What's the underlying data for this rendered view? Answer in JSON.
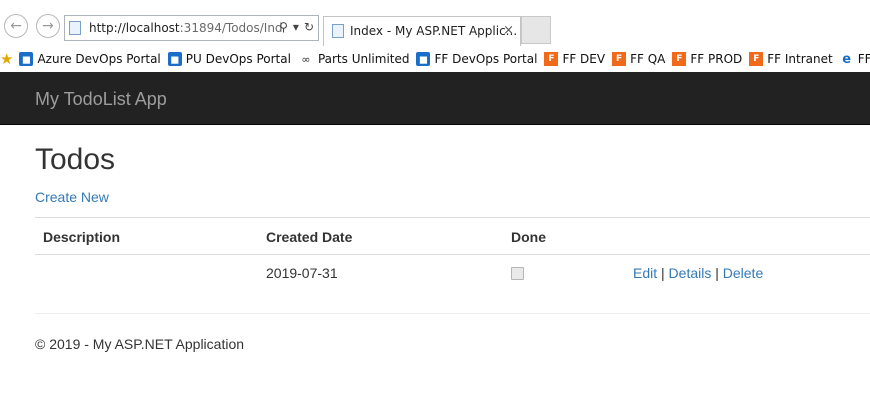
{
  "browser": {
    "address_url_host": "http://localhost",
    "address_url_rest": ":31894/Todos/Ind",
    "tab_title": "Index - My ASP.NET Applic...",
    "tab_close": "×",
    "back_icon": "←",
    "forward_icon": "→",
    "search_icon": "⚲",
    "dropdown_icon": "▾",
    "refresh_icon": "↻"
  },
  "favorites": [
    {
      "label": "Azure DevOps Portal",
      "icon": "devops-icon"
    },
    {
      "label": "PU DevOps Portal",
      "icon": "devops-icon"
    },
    {
      "label": "Parts Unlimited",
      "icon": "parts-icon"
    },
    {
      "label": "FF DevOps Portal",
      "icon": "devops-icon"
    },
    {
      "label": "FF DEV",
      "icon": "ff-icon"
    },
    {
      "label": "FF QA",
      "icon": "ff-icon"
    },
    {
      "label": "FF PROD",
      "icon": "ff-icon"
    },
    {
      "label": "FF Intranet",
      "icon": "ff-icon"
    },
    {
      "label": "FF Custome",
      "icon": "ie-icon"
    }
  ],
  "app": {
    "brand": "My TodoList App",
    "page_title": "Todos",
    "create_new": "Create New"
  },
  "table": {
    "headers": [
      "Description",
      "Created Date",
      "Done"
    ],
    "rows": [
      {
        "description": "",
        "created_date": "2019-07-31",
        "done": false
      }
    ],
    "actions": {
      "edit": "Edit",
      "details": "Details",
      "delete": "Delete",
      "separator": "|"
    }
  },
  "footer": {
    "text": "© 2019 - My ASP.NET Application"
  },
  "colors": {
    "navbar_bg": "#222222",
    "brand_text": "#9d9d9d",
    "link": "#337ab7"
  }
}
